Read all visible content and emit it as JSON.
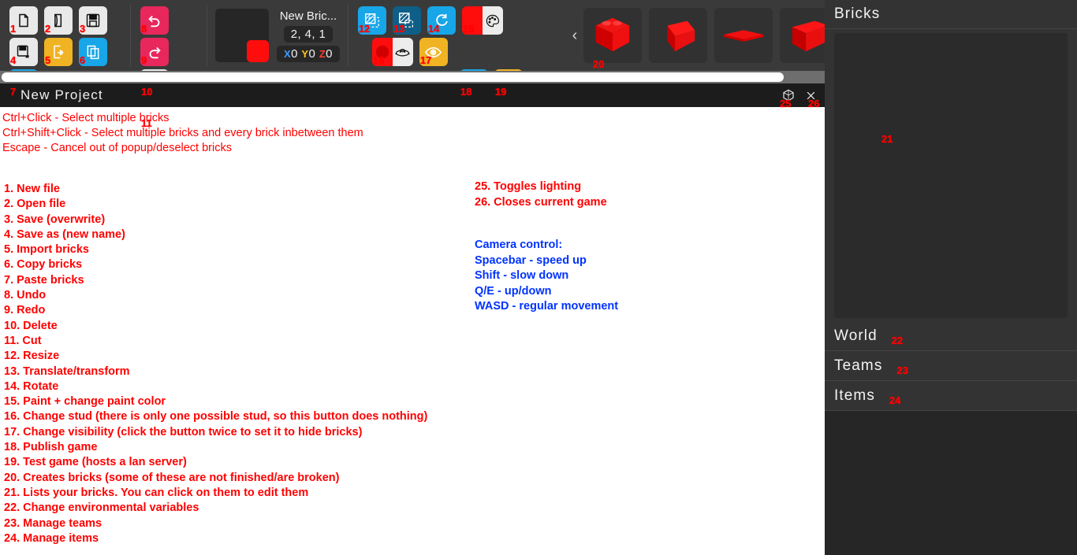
{
  "toolbar": {
    "buttons": [
      {
        "n": "1",
        "name": "new-file-button",
        "icon": "file-icon",
        "style": "b-white"
      },
      {
        "n": "2",
        "name": "open-file-button",
        "icon": "folder-open-icon",
        "style": "b-white"
      },
      {
        "n": "3",
        "name": "save-button",
        "icon": "floppy-save-icon",
        "style": "b-white"
      },
      {
        "n": "4",
        "name": "save-as-button",
        "icon": "floppy-save-as-icon",
        "style": "b-white"
      },
      {
        "n": "5",
        "name": "import-bricks-button",
        "icon": "import-icon",
        "style": "b-yellow"
      },
      {
        "n": "6",
        "name": "copy-bricks-button",
        "icon": "copy-icon",
        "style": "b-blue"
      },
      {
        "n": "7",
        "name": "paste-bricks-button",
        "icon": "paste-icon",
        "style": "b-blue"
      },
      {
        "n": "8",
        "name": "undo-button",
        "icon": "undo-arrow-icon",
        "style": "b-pink"
      },
      {
        "n": "9",
        "name": "redo-button",
        "icon": "redo-arrow-icon",
        "style": "b-pink"
      },
      {
        "n": "10",
        "name": "delete-button",
        "icon": "trash-icon",
        "style": "b-white"
      },
      {
        "n": "11",
        "name": "cut-button",
        "icon": "scissors-icon",
        "style": "b-white"
      },
      {
        "n": "12",
        "name": "resize-tool-button",
        "icon": "resize-icon",
        "style": "b-blue"
      },
      {
        "n": "13",
        "name": "translate-tool-button",
        "icon": "translate-icon",
        "style": "b-bluedk"
      },
      {
        "n": "14",
        "name": "rotate-tool-button",
        "icon": "rotate-icon",
        "style": "b-blue"
      },
      {
        "n": "15",
        "name": "paint-tool-button",
        "icon": "palette-icon",
        "style": "split"
      },
      {
        "n": "16",
        "name": "change-stud-button",
        "icon": "stud-icon",
        "style": "split"
      },
      {
        "n": "17",
        "name": "visibility-button",
        "icon": "eye-icon",
        "style": "b-yellow"
      },
      {
        "n": "18",
        "name": "publish-game-button",
        "icon": "publish-file-icon",
        "style": "b-blue"
      },
      {
        "n": "19",
        "name": "test-game-button",
        "icon": "code-play-icon",
        "style": "b-yellow"
      }
    ]
  },
  "brick_info": {
    "name": "New Bric...",
    "size": "2, 4, 1",
    "position": {
      "x_label": "X",
      "x": "0",
      "y_label": "Y",
      "y": "0",
      "z_label": "Z",
      "z": "0"
    },
    "color_hex": "#ff0d0d"
  },
  "palette": {
    "prev_arrow": "‹",
    "callout": "20",
    "items": [
      {
        "name": "brick-preview-cube"
      },
      {
        "name": "brick-preview-wedge"
      },
      {
        "name": "brick-preview-plate"
      },
      {
        "name": "brick-preview-slab"
      }
    ]
  },
  "project": {
    "title": "New Project",
    "lighting_icon": "lighting-cube-icon",
    "lighting_callout": "25",
    "close_icon": "close-x-icon",
    "close_callout": "26"
  },
  "hints": [
    "Ctrl+Click - Select multiple bricks",
    "Ctrl+Shift+Click - Select multiple bricks and every brick inbetween them",
    "Escape - Cancel out of popup/deselect bricks"
  ],
  "legend_left": [
    "1. New file",
    "2. Open file",
    "3. Save (overwrite)",
    "4. Save as (new name)",
    "5. Import bricks",
    "6. Copy bricks",
    "7. Paste bricks",
    "8. Undo",
    "9. Redo",
    "10. Delete",
    "11. Cut",
    "12. Resize",
    "13. Translate/transform",
    "14. Rotate",
    "15. Paint + change paint color",
    "16. Change stud (there is only one possible stud, so this button does nothing)",
    "17. Change visibility (click the button twice to set it to hide bricks)",
    "18. Publish game",
    "19. Test game (hosts a lan server)",
    "20. Creates bricks (some of these are not finished/are broken)",
    "21. Lists your bricks. You can click on them to edit them",
    "22. Change environmental variables",
    "23. Manage teams",
    "24. Manage items"
  ],
  "legend_right": [
    "25. Toggles lighting",
    "26. Closes current game"
  ],
  "camera_control": [
    "Camera control:",
    "Spacebar - speed up",
    "Shift - slow down",
    "Q/E - up/down",
    "WASD - regular movement"
  ],
  "right_panel": {
    "header": "Bricks",
    "brick_list_callout": "21",
    "sections": [
      {
        "label": "World",
        "callout": "22",
        "name": "sidebar-section-world"
      },
      {
        "label": "Teams",
        "callout": "23",
        "name": "sidebar-section-teams"
      },
      {
        "label": "Items",
        "callout": "24",
        "name": "sidebar-section-items"
      }
    ]
  },
  "colors": {
    "accent_red": "#ff0000",
    "accent_blue": "#0033ff",
    "toolbar_bg": "#3a3a3a",
    "panel_bg": "#333333"
  }
}
